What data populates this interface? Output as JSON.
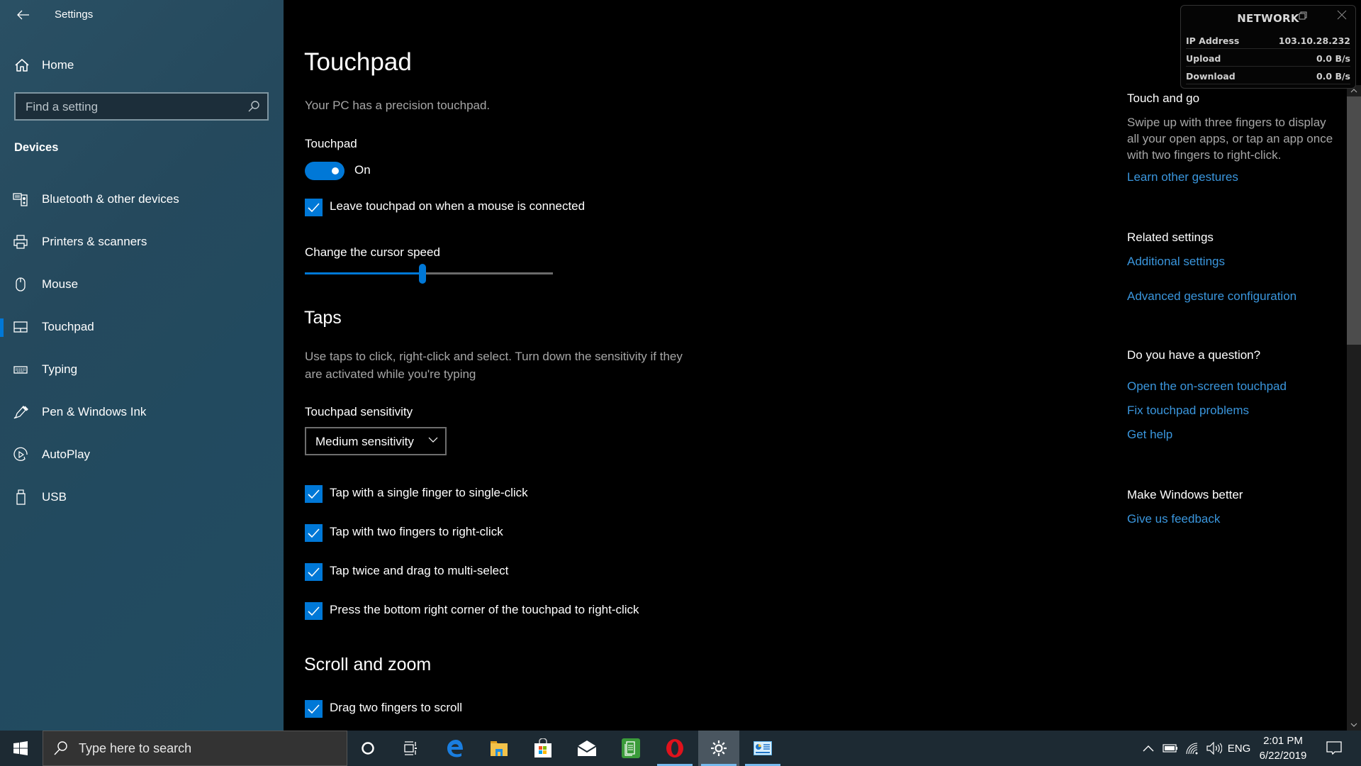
{
  "window": {
    "title": "Settings"
  },
  "sidebar": {
    "home_label": "Home",
    "search_placeholder": "Find a setting",
    "section_title": "Devices",
    "items": [
      {
        "label": "Bluetooth & other devices",
        "icon": "bluetooth-devices-icon",
        "selected": false
      },
      {
        "label": "Printers & scanners",
        "icon": "printer-icon",
        "selected": false
      },
      {
        "label": "Mouse",
        "icon": "mouse-icon",
        "selected": false
      },
      {
        "label": "Touchpad",
        "icon": "touchpad-icon",
        "selected": true
      },
      {
        "label": "Typing",
        "icon": "keyboard-icon",
        "selected": false
      },
      {
        "label": "Pen & Windows Ink",
        "icon": "pen-icon",
        "selected": false
      },
      {
        "label": "AutoPlay",
        "icon": "autoplay-icon",
        "selected": false
      },
      {
        "label": "USB",
        "icon": "usb-icon",
        "selected": false
      }
    ]
  },
  "main": {
    "title": "Touchpad",
    "precision_note": "Your PC has a precision touchpad.",
    "touchpad_label": "Touchpad",
    "touchpad_toggle": {
      "on": true,
      "state_label": "On"
    },
    "leave_on_checkbox": {
      "label": "Leave touchpad on when a mouse is connected",
      "checked": true
    },
    "cursor_speed": {
      "label": "Change the cursor speed",
      "value": 10,
      "min": 1,
      "max": 20
    },
    "taps": {
      "heading": "Taps",
      "description_line1": "Use taps to click, right-click and select. Turn down the sensitivity if they",
      "description_line2": "are activated while you're typing",
      "sensitivity_label": "Touchpad sensitivity",
      "sensitivity_value": "Medium sensitivity",
      "options": [
        {
          "label": "Tap with a single finger to single-click",
          "checked": true
        },
        {
          "label": "Tap with two fingers to right-click",
          "checked": true
        },
        {
          "label": "Tap twice and drag to multi-select",
          "checked": true
        },
        {
          "label": "Press the bottom right corner of the touchpad to right-click",
          "checked": true
        }
      ]
    },
    "scroll_zoom": {
      "heading": "Scroll and zoom",
      "options": [
        {
          "label": "Drag two fingers to scroll",
          "checked": true
        }
      ]
    }
  },
  "right_panel": {
    "touch_and_go": {
      "heading": "Touch and go",
      "text_line1": "Swipe up with three fingers to display",
      "text_line2": "all your open apps, or tap an app once",
      "text_line3": "with two fingers to right-click.",
      "link": "Learn other gestures"
    },
    "related_settings": {
      "heading": "Related settings",
      "links": [
        "Additional settings",
        "Advanced gesture configuration"
      ]
    },
    "question": {
      "heading": "Do you have a question?",
      "links": [
        "Open the on-screen touchpad",
        "Fix touchpad problems",
        "Get help"
      ]
    },
    "feedback": {
      "heading": "Make Windows better",
      "link": "Give us feedback"
    }
  },
  "network_widget": {
    "title": "NETWORK",
    "rows": [
      {
        "key": "IP Address",
        "value": "103.10.28.232"
      },
      {
        "key": "Upload",
        "value": "0.0 B/s"
      },
      {
        "key": "Download",
        "value": "0.0 B/s"
      }
    ]
  },
  "taskbar": {
    "search_placeholder": "Type here to search",
    "apps": [
      {
        "name": "cortana",
        "running": false,
        "active": false
      },
      {
        "name": "task-view",
        "running": false,
        "active": false
      },
      {
        "name": "edge",
        "running": false,
        "active": false
      },
      {
        "name": "file-explorer",
        "running": false,
        "active": false
      },
      {
        "name": "microsoft-store",
        "running": false,
        "active": false
      },
      {
        "name": "mail",
        "running": false,
        "active": false
      },
      {
        "name": "green-notes-app",
        "running": false,
        "active": false
      },
      {
        "name": "opera",
        "running": true,
        "active": false
      },
      {
        "name": "settings",
        "running": true,
        "active": true
      },
      {
        "name": "control-panel",
        "running": true,
        "active": false
      }
    ],
    "tray": {
      "language": "ENG",
      "time": "2:01 PM",
      "date": "6/22/2019"
    }
  },
  "colors": {
    "accent": "#0078d7",
    "link": "#3a96dd",
    "sidebar_bg": "#25495d",
    "main_bg": "#000000",
    "taskbar_bg": "#1d2a33"
  }
}
